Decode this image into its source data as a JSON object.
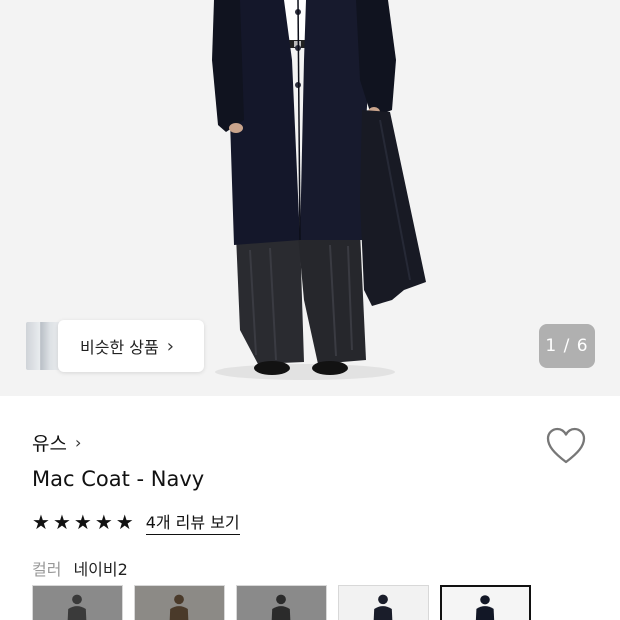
{
  "similar_products": {
    "label": "비슷한 상품",
    "chevron": "›"
  },
  "image_counter": "1 / 6",
  "product": {
    "brand": "유스",
    "brand_chevron": "›",
    "name": "Mac Coat - Navy",
    "rating_stars": 5,
    "review_link": "4개 리뷰 보기",
    "wishlisted": false
  },
  "color": {
    "label": "컬러",
    "value": "네이비2"
  },
  "swatches": [
    {
      "bg": "#8a8a8a",
      "figure": "#3a3a3a",
      "selected": false
    },
    {
      "bg": "#8c8a86",
      "figure": "#4a3a2a",
      "selected": false
    },
    {
      "bg": "#8a8a8a",
      "figure": "#2b2b2b",
      "selected": false
    },
    {
      "bg": "#f2f2f2",
      "figure": "#1a1d2a",
      "selected": false
    },
    {
      "bg": "#f5f5f5",
      "figure": "#121726",
      "selected": true
    }
  ],
  "colors": {
    "accent": "#111111",
    "muted": "#999999",
    "hero_bg": "#f3f3f3"
  },
  "icons": {
    "heart": "heart-outline-icon",
    "star": "star-icon",
    "chevron": "chevron-right-icon"
  }
}
